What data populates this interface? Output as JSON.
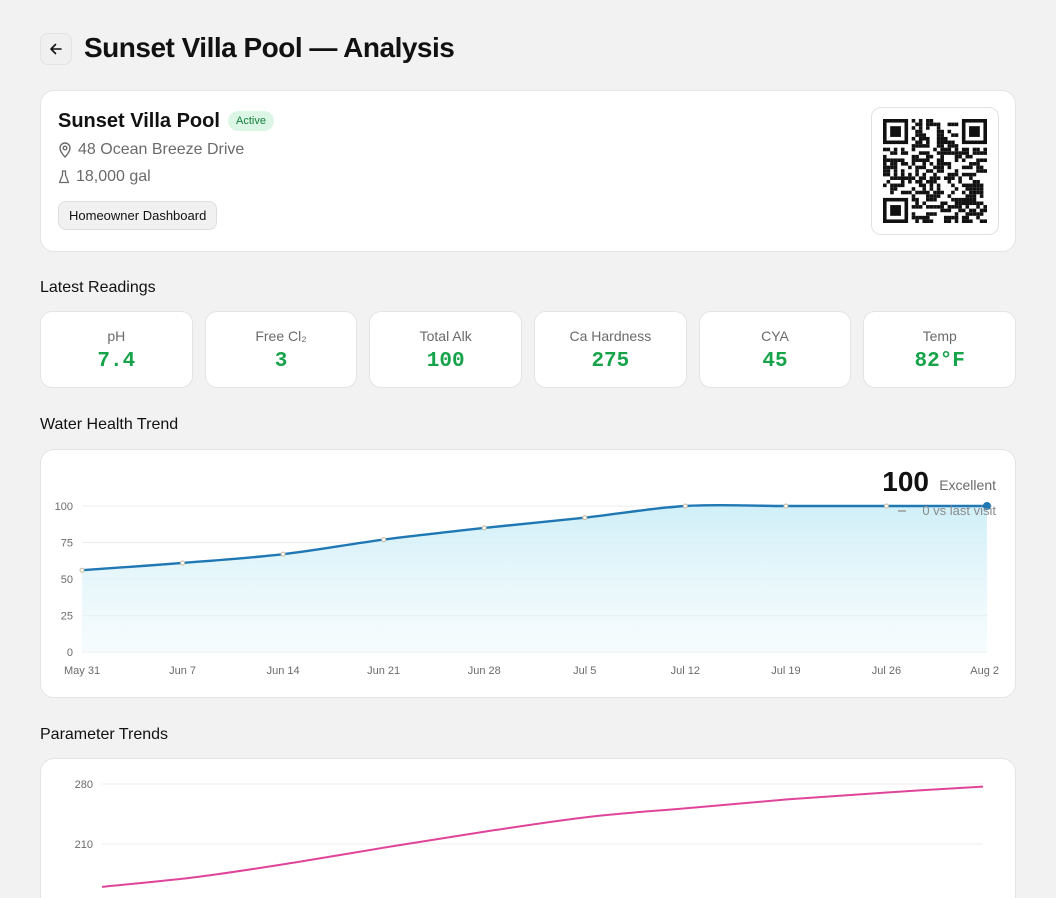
{
  "header": {
    "title": "Sunset Villa Pool — Analysis",
    "back_icon": "arrow-left-icon"
  },
  "pool": {
    "name": "Sunset Villa Pool",
    "status": "Active",
    "address": "48 Ocean Breeze Drive",
    "volume": "18,000 gal",
    "dashboard_button": "Homeowner Dashboard",
    "qr_icon": "qr-code-icon"
  },
  "colors": {
    "accent_green": "#16a34a",
    "health_line": "#1f78b4",
    "param_line": "#e0449a"
  },
  "sections": {
    "readings": "Latest Readings",
    "health": "Water Health Trend",
    "params": "Parameter Trends"
  },
  "readings": [
    {
      "label": "pH",
      "value": "7.4"
    },
    {
      "label": "Free Cl₂",
      "value": "3"
    },
    {
      "label": "Total Alk",
      "value": "100"
    },
    {
      "label": "Ca Hardness",
      "value": "275"
    },
    {
      "label": "CYA",
      "value": "45"
    },
    {
      "label": "Temp",
      "value": "82°F"
    }
  ],
  "health_summary": {
    "score": "100",
    "rating": "Excellent",
    "delta": "0 vs last visit"
  },
  "chart_data": [
    {
      "type": "area",
      "x": [
        "May 31",
        "Jun 7",
        "Jun 14",
        "Jun 21",
        "Jun 28",
        "Jul 5",
        "Jul 12",
        "Jul 19",
        "Jul 26",
        "Aug 2"
      ],
      "values": [
        56,
        61,
        67,
        77,
        85,
        92,
        100,
        100,
        100,
        100
      ],
      "ylim": [
        0,
        100
      ],
      "yticks": [
        "0",
        "25",
        "50",
        "75",
        "100"
      ],
      "grid": true
    },
    {
      "type": "line",
      "values": [
        160,
        172,
        189,
        208,
        226,
        242,
        252,
        262,
        270,
        277
      ],
      "ylim": [
        140,
        280
      ],
      "yticks": [
        "210",
        "280"
      ],
      "grid": true
    }
  ]
}
